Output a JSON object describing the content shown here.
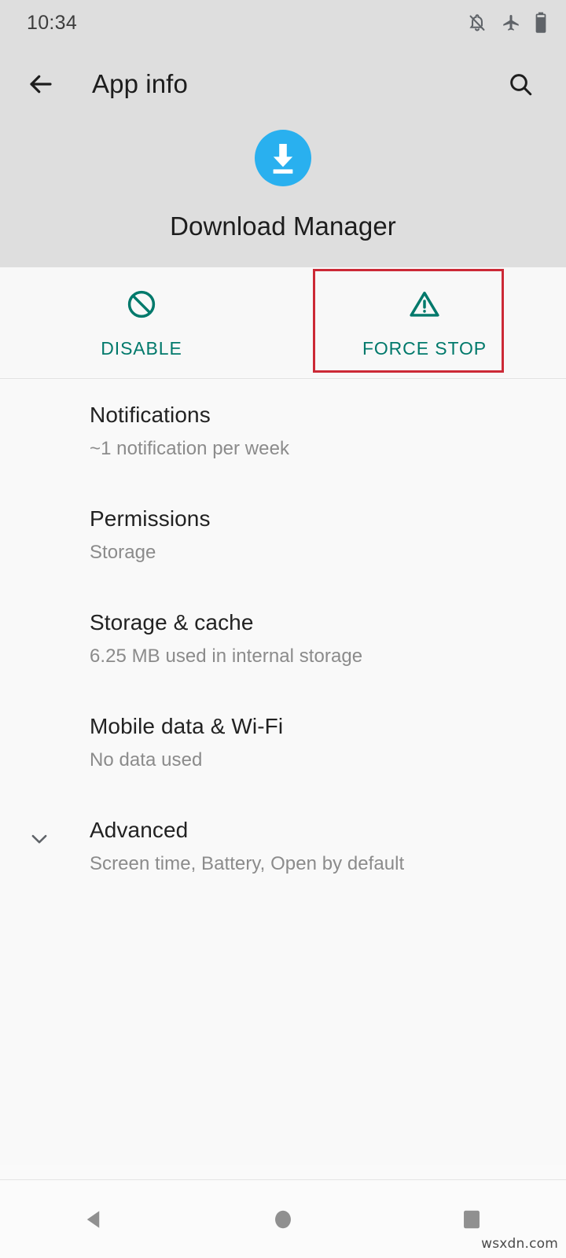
{
  "status_bar": {
    "time": "10:34",
    "icons": [
      {
        "name": "notifications-off-icon",
        "label": "Notifications silenced"
      },
      {
        "name": "airplane-mode-icon",
        "label": "Airplane mode on"
      },
      {
        "name": "battery-icon",
        "label": "Battery"
      }
    ]
  },
  "app_bar": {
    "back_label": "Back",
    "title": "App info",
    "search_label": "Search"
  },
  "app": {
    "name": "Download Manager",
    "icon_name": "download-manager-icon",
    "icon_color": "#29b0ef"
  },
  "actions": {
    "accent_color": "#00796b",
    "highlight_color": "#cc2936",
    "items": [
      {
        "label": "DISABLE",
        "icon": "disable-icon",
        "highlighted": false
      },
      {
        "label": "FORCE STOP",
        "icon": "warning-triangle-icon",
        "highlighted": true
      }
    ]
  },
  "settings": {
    "items": [
      {
        "title": "Notifications",
        "subtitle": "~1 notification per week",
        "expandable": false
      },
      {
        "title": "Permissions",
        "subtitle": "Storage",
        "expandable": false
      },
      {
        "title": "Storage & cache",
        "subtitle": "6.25 MB used in internal storage",
        "expandable": false
      },
      {
        "title": "Mobile data & Wi-Fi",
        "subtitle": "No data used",
        "expandable": false
      },
      {
        "title": "Advanced",
        "subtitle": "Screen time, Battery, Open by default",
        "expandable": true
      }
    ]
  },
  "nav_bar": {
    "buttons": [
      {
        "name": "back-nav-button",
        "label": "Back"
      },
      {
        "name": "home-nav-button",
        "label": "Home"
      },
      {
        "name": "recents-nav-button",
        "label": "Recents"
      }
    ]
  },
  "watermark": "wsxdn.com"
}
